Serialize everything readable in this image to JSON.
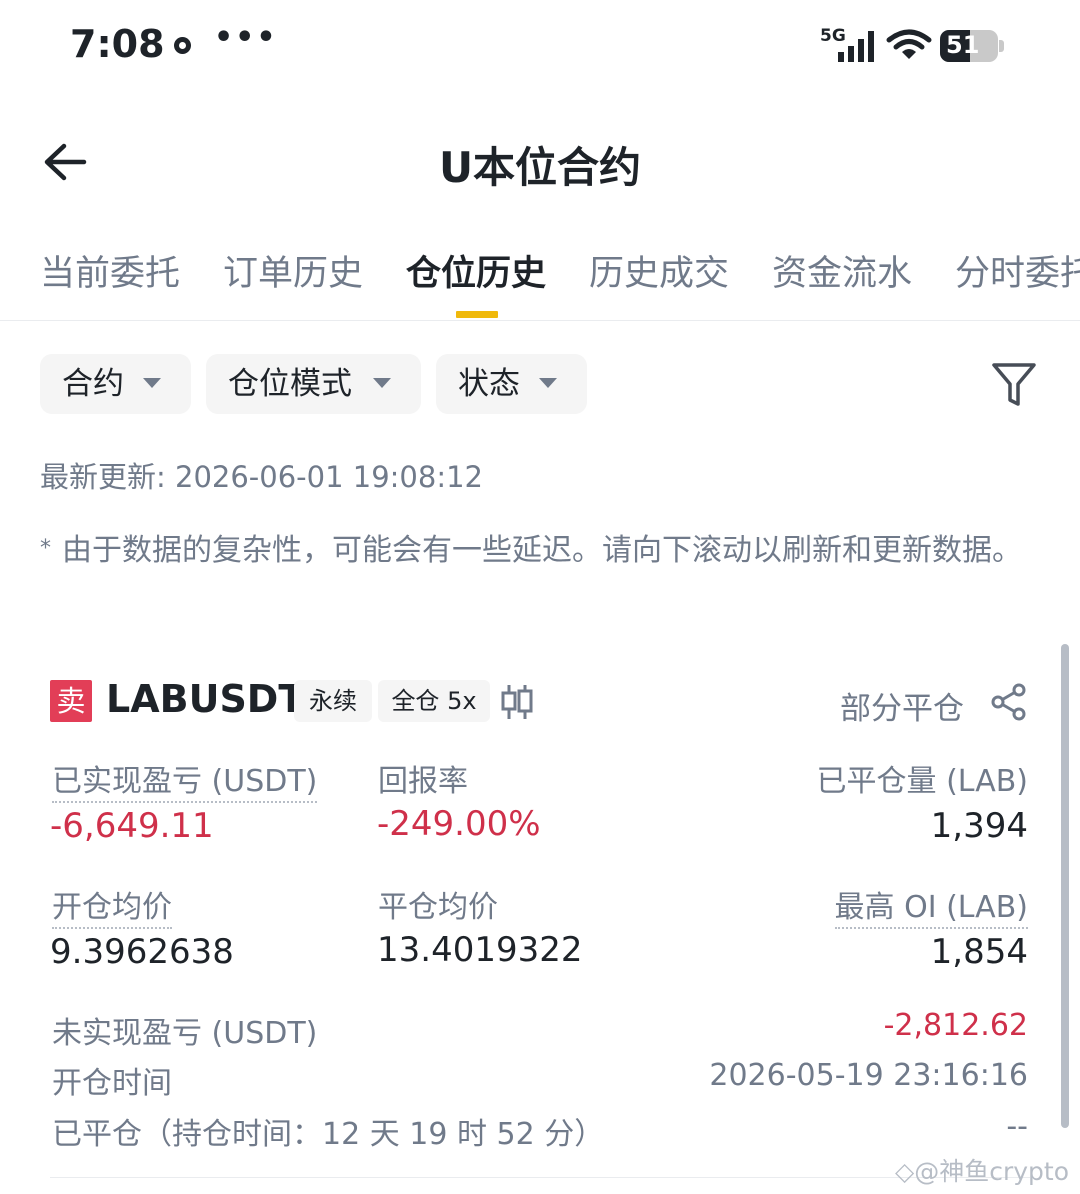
{
  "status_bar": {
    "time": "7:08",
    "more": "•••",
    "network": "5G",
    "battery": "51",
    "battery_level_percent": 51
  },
  "header": {
    "title": "U本位合约"
  },
  "tabs": [
    {
      "label": "当前委托"
    },
    {
      "label": "订单历史"
    },
    {
      "label": "仓位历史",
      "active": true
    },
    {
      "label": "历史成交"
    },
    {
      "label": "资金流水"
    },
    {
      "label": "分时委托"
    }
  ],
  "filters": {
    "contract": "合约",
    "position_mode": "仓位模式",
    "status": "状态"
  },
  "updated": "最新更新: 2026-06-01 19:08:12",
  "notice": "由于数据的复杂性，可能会有一些延迟。请向下滚动以刷新和更新数据。",
  "position": {
    "side": "卖",
    "symbol": "LABUSDT",
    "contract_type": "永续",
    "margin_leverage": "全仓 5x",
    "close_type": "部分平仓",
    "realized_pnl_label": "已实现盈亏 (USDT)",
    "realized_pnl": "-6,649.11",
    "roi_label": "回报率",
    "roi": "-249.00%",
    "closed_qty_label": "已平仓量 (LAB)",
    "closed_qty": "1,394",
    "entry_price_label": "开仓均价",
    "entry_price": "9.3962638",
    "close_price_label": "平仓均价",
    "close_price": "13.4019322",
    "max_oi_label": "最高 OI (LAB)",
    "max_oi": "1,854",
    "unrealized_pnl_label": "未实现盈亏 (USDT)",
    "unrealized_pnl": "-2,812.62",
    "open_time_label": "开仓时间",
    "open_time": "2026-05-19 23:16:16",
    "closed_label": "已平仓（持仓时间：12 天 19 时 52 分）",
    "closed_value": "--"
  },
  "watermark": "◇@神鱼crypto",
  "colors": {
    "accent": "#f0b90b",
    "sell": "#e23e57",
    "negative": "#cf304a",
    "text_primary": "#1e2329",
    "text_secondary": "#707a8a"
  }
}
